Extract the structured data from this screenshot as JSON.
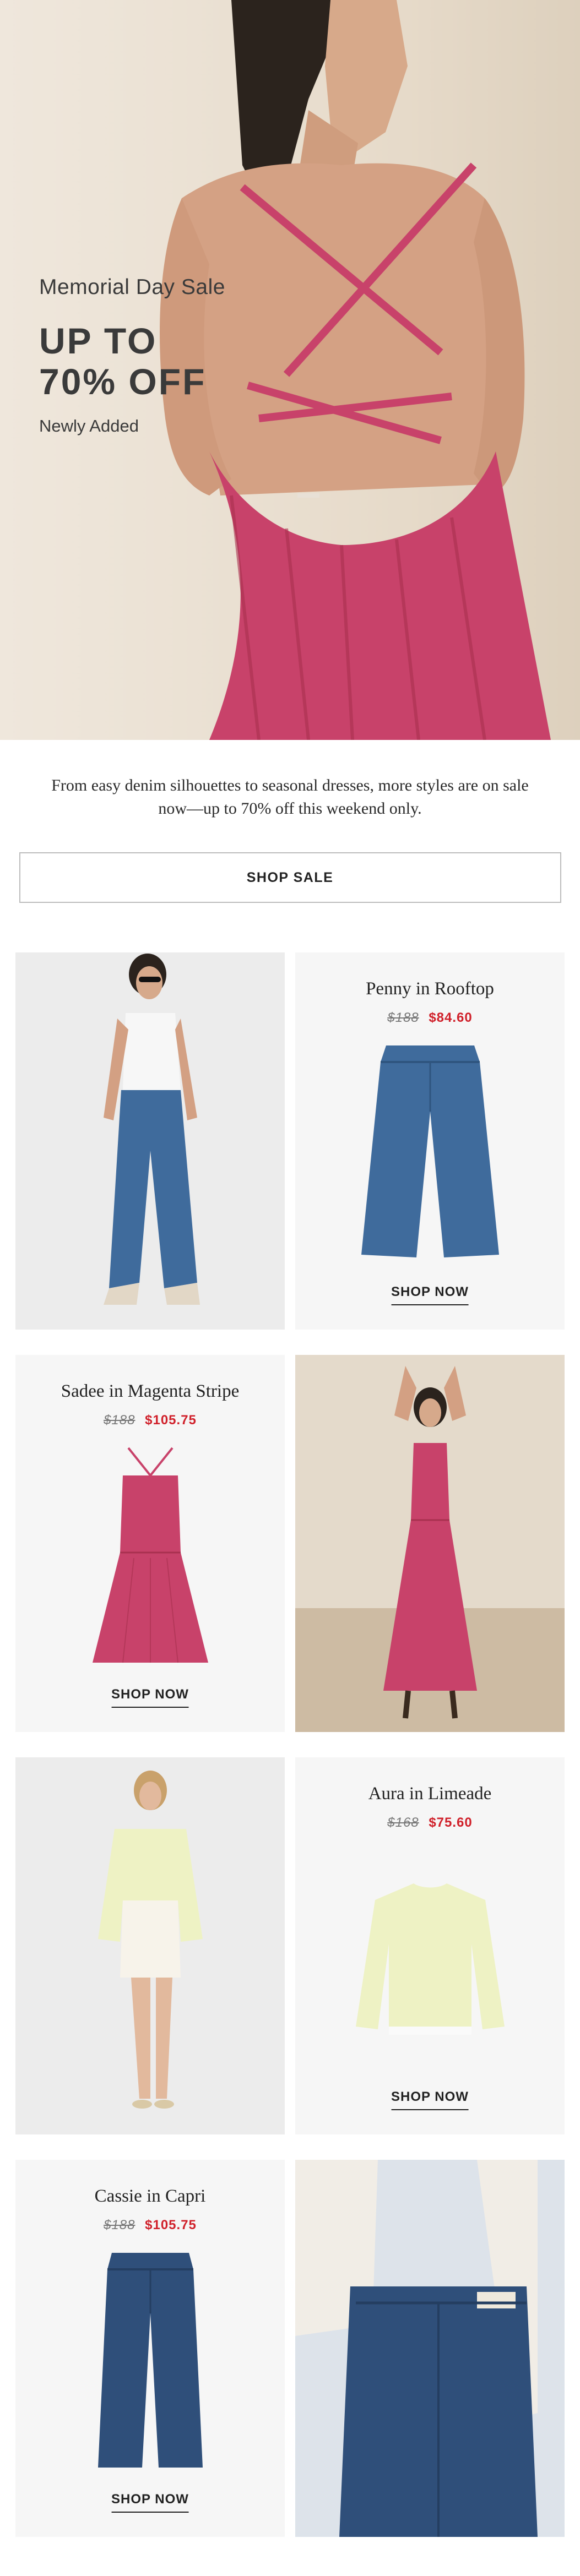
{
  "hero": {
    "eyebrow": "Memorial Day Sale",
    "headline_line1": "UP TO",
    "headline_line2": "70% OFF",
    "subline": "Newly Added"
  },
  "intro": {
    "text": "From easy denim silhouettes to seasonal dresses, more styles are on sale now—up to 70% off this weekend only.",
    "button_label": "SHOP SALE"
  },
  "products": [
    {
      "name": "Penny in Rooftop",
      "was": "$188",
      "now": "$84.60",
      "cta": "SHOP NOW"
    },
    {
      "name": "Sadee in Magenta Stripe",
      "was": "$188",
      "now": "$105.75",
      "cta": "SHOP NOW"
    },
    {
      "name": "Aura in Limeade",
      "was": "$168",
      "now": "$75.60",
      "cta": "SHOP NOW"
    },
    {
      "name": "Cassie in Capri",
      "was": "$188",
      "now": "$105.75",
      "cta": "SHOP NOW"
    }
  ],
  "colors": {
    "sale_red": "#d0202a",
    "dress_magenta": "#c8426a",
    "denim": "#3f6b9c",
    "limeade": "#eef2c4"
  }
}
